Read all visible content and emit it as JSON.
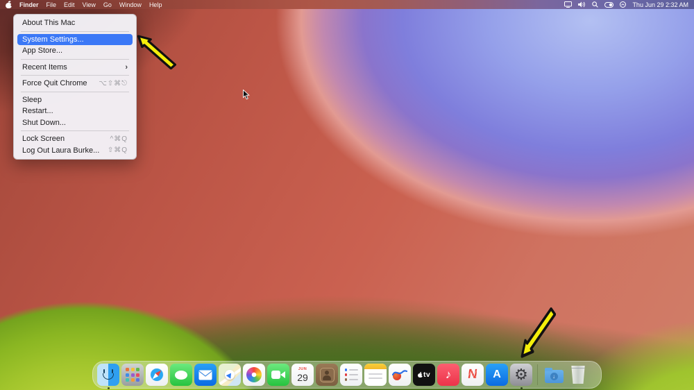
{
  "menu_bar": {
    "app_name": "Finder",
    "menus": [
      "Finder",
      "File",
      "Edit",
      "View",
      "Go",
      "Window",
      "Help"
    ],
    "status_icons": [
      "screen-mirroring",
      "volume",
      "search",
      "control-center",
      "siri"
    ],
    "clock": "Thu Jun 29 2:32 AM"
  },
  "apple_menu": {
    "highlight_color": "#3b78f6",
    "items": {
      "about": "About This Mac",
      "system_settings": "System Settings...",
      "app_store": "App Store...",
      "recent_items": "Recent Items",
      "recent_items_chevron": "›",
      "force_quit": "Force Quit Chrome",
      "force_quit_shortcut": "⌥⇧⌘⎋",
      "sleep": "Sleep",
      "restart": "Restart...",
      "shut_down": "Shut Down...",
      "lock_screen": "Lock Screen",
      "lock_screen_shortcut": "^⌘Q",
      "log_out": "Log Out Laura Burke...",
      "log_out_shortcut": "⇧⌘Q"
    },
    "highlighted_item": "System Settings..."
  },
  "dock": {
    "apps": [
      "Finder",
      "Launchpad",
      "Safari",
      "Messages",
      "Mail",
      "Maps",
      "Photos",
      "FaceTime",
      "Calendar",
      "Contacts",
      "Reminders",
      "Notes",
      "Freeform",
      "TV",
      "Music",
      "News",
      "App Store",
      "System Settings",
      "Downloads",
      "Trash"
    ],
    "running_apps": [
      "Finder",
      "System Settings"
    ],
    "calendar_month": "JUN",
    "calendar_day": "29",
    "tv_label": "tv",
    "music_glyph": "♪",
    "news_glyph": "N",
    "app_store_glyph": "A",
    "settings_gear_glyph": "⚙",
    "downloads_arrow_glyph": "↓"
  },
  "annotations": {
    "arrow_color": "#f4ee0a",
    "targets": [
      "System Settings... menu item",
      "System Settings dock icon"
    ]
  }
}
